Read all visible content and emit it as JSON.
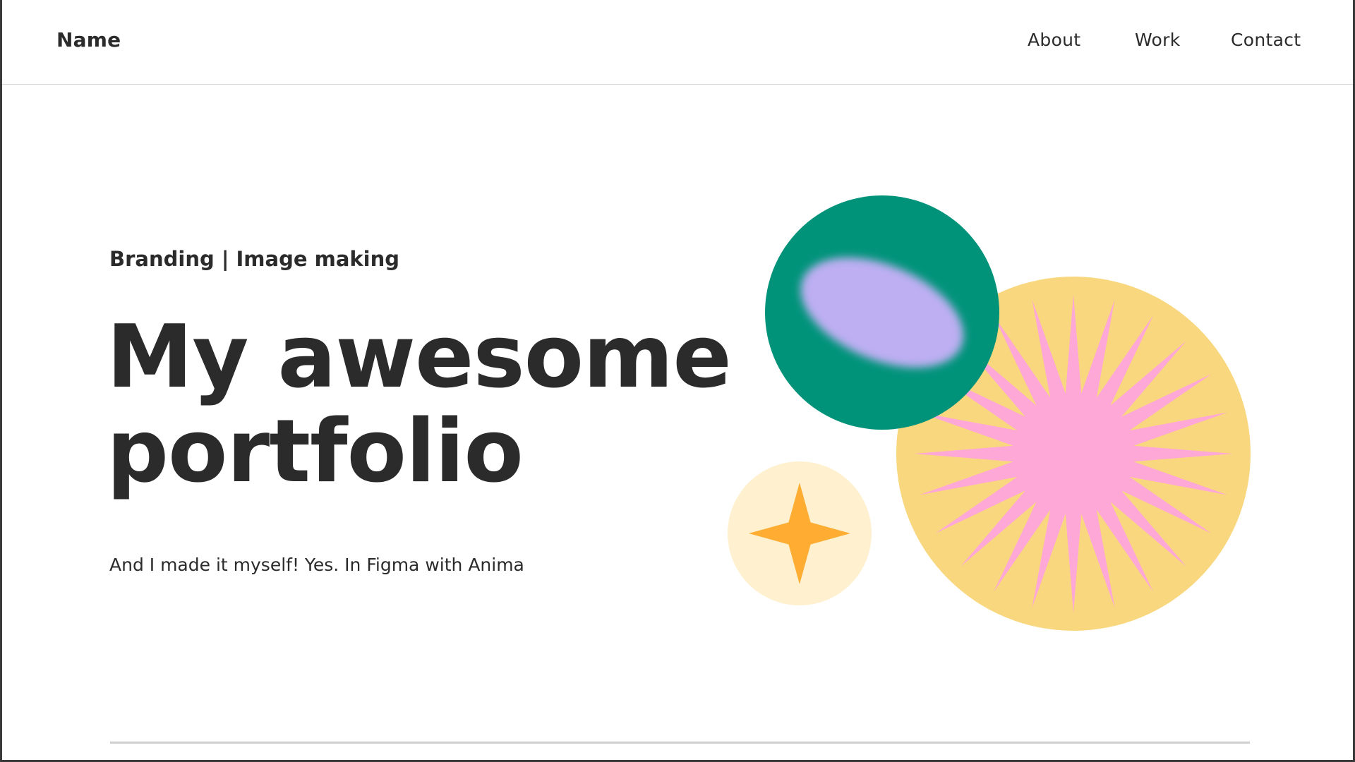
{
  "header": {
    "brand": "Name",
    "nav": {
      "about": "About",
      "work": "Work",
      "contact": "Contact"
    }
  },
  "hero": {
    "tagline": "Branding | Image making",
    "headline_line1": "My awesome",
    "headline_line2": "portfolio",
    "subtext": "And I made it myself!  Yes. In Figma with Anima"
  },
  "illustration": {
    "green_circle_color": "#00937a",
    "lavender_blob_color": "#bdaff2",
    "yellow_circle_color": "#f8d77f",
    "pink_star_color": "#fda8d6",
    "cream_circle_color": "#fff1cf",
    "orange_star_color": "#fead32",
    "shapes": [
      "green-circle",
      "lavender-blob",
      "yellow-circle",
      "pink-burst-star",
      "cream-circle",
      "orange-four-point-star"
    ]
  }
}
